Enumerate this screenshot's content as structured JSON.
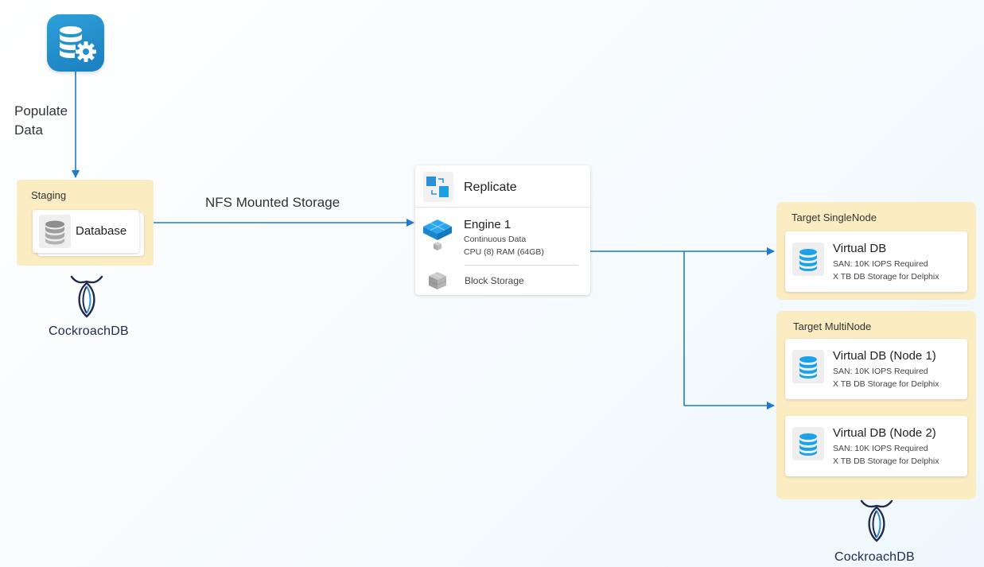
{
  "source": {
    "icon": "database-gear-icon"
  },
  "edges": {
    "populate_label_line1": "Populate",
    "populate_label_line2": "Data",
    "nfs_label": "NFS Mounted Storage"
  },
  "staging": {
    "title": "Staging",
    "card_label": "Database",
    "card_icon": "database-icon"
  },
  "brand": {
    "name": "CockroachDB"
  },
  "engine_panel": {
    "replicate_label": "Replicate",
    "engine_title": "Engine 1",
    "engine_lines": [
      "Continuous Data",
      "CPU (8) RAM (64GB)"
    ],
    "block_storage_label": "Block Storage"
  },
  "targets": {
    "single": {
      "title": "Target SingleNode",
      "cards": [
        {
          "title": "Virtual DB",
          "line1": "SAN: 10K IOPS Required",
          "line2": "X TB DB Storage for Delphix"
        }
      ]
    },
    "multi": {
      "title": "Target MultiNode",
      "cards": [
        {
          "title": "Virtual DB (Node 1)",
          "line1": "SAN: 10K IOPS Required",
          "line2": "X TB DB Storage for Delphix"
        },
        {
          "title": "Virtual DB (Node 2)",
          "line1": "SAN: 10K IOPS Required",
          "line2": "X TB DB Storage for Delphix"
        }
      ]
    }
  },
  "colors": {
    "arrow": "#1f7acc",
    "group_fill": "#fbecc2",
    "vdb_icon": "#1aa3e8",
    "brand_dark": "#1f2b4d",
    "brand_teal": "#3a8fd0"
  }
}
